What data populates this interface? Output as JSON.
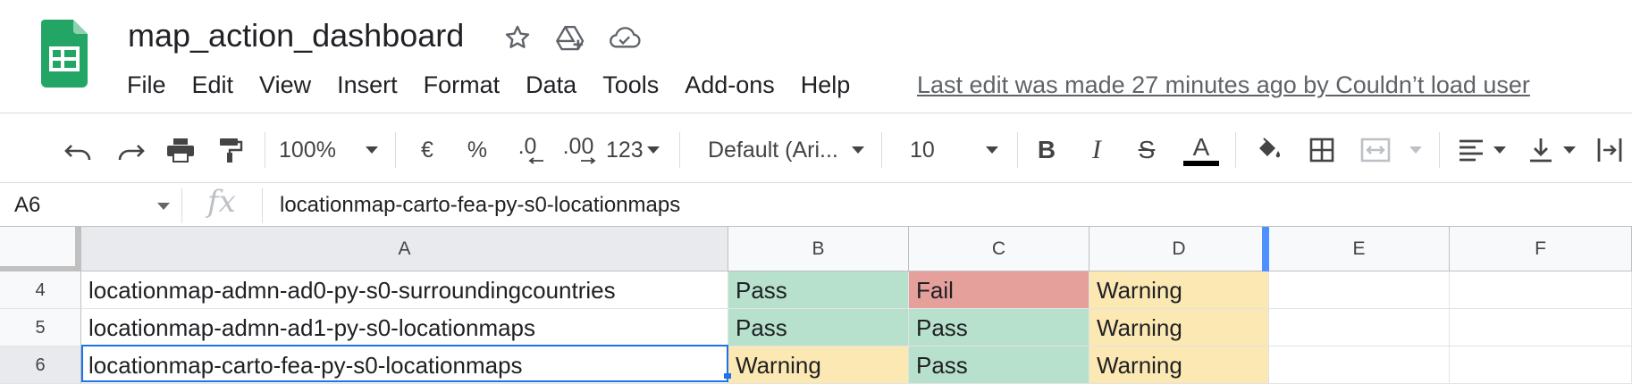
{
  "document": {
    "title": "map_action_dashboard",
    "last_edit": "Last edit was made 27 minutes ago by Couldn’t load user"
  },
  "header_icons": [
    "star-icon",
    "move-to-drive-icon",
    "cloud-saved-icon"
  ],
  "menu": [
    "File",
    "Edit",
    "View",
    "Insert",
    "Format",
    "Data",
    "Tools",
    "Add-ons",
    "Help"
  ],
  "toolbar": {
    "zoom": "100%",
    "currency": "€",
    "percent": "%",
    "decrease_decimal": ".0",
    "increase_decimal": ".00",
    "more_formats": "123",
    "font": "Default (Ari...",
    "font_size": "10",
    "bold": "B",
    "italic": "I",
    "strikethrough": "S",
    "text_color": "A"
  },
  "formula_bar": {
    "cell_ref": "A6",
    "fx": "fx",
    "value": "locationmap-carto-fea-py-s0-locationmaps"
  },
  "columns": [
    "A",
    "B",
    "C",
    "D",
    "E",
    "F"
  ],
  "rows": [
    {
      "num": "4",
      "a": "locationmap-admn-ad0-py-s0-surroundingcountries",
      "b": "Pass",
      "c": "Fail",
      "d": "Warning"
    },
    {
      "num": "5",
      "a": "locationmap-admn-ad1-py-s0-locationmaps",
      "b": "Pass",
      "c": "Pass",
      "d": "Warning"
    },
    {
      "num": "6",
      "a": "locationmap-carto-fea-py-s0-locationmaps",
      "b": "Warning",
      "c": "Pass",
      "d": "Warning"
    }
  ],
  "colors": {
    "pass": "#b7e1cd",
    "fail": "#e6a09c",
    "warning": "#fce8b2",
    "selection": "#1a73e8",
    "sheets_green": "#23a566"
  }
}
